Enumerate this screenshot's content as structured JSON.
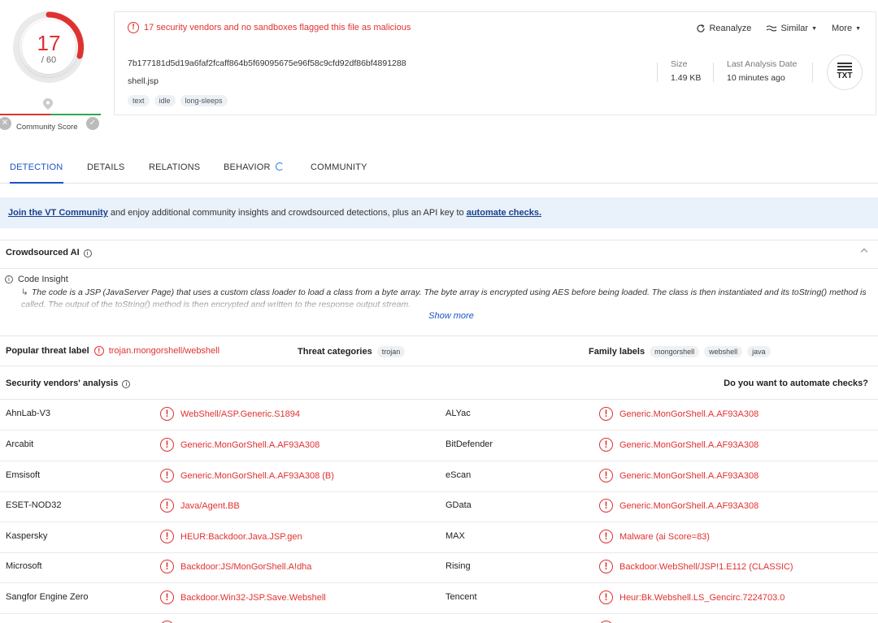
{
  "score": {
    "detections": "17",
    "total": "/ 60",
    "community_label": "Community Score",
    "community_negative": "✕",
    "community_positive": "✓",
    "accent": "#e03131"
  },
  "header": {
    "alert": "17 security vendors and no sandboxes flagged this file as malicious",
    "actions": {
      "reanalyze": "Reanalyze",
      "similar": "Similar",
      "more": "More"
    },
    "hash": "7b177181d5d19a6faf2fcaff864b5f69095675e96f58c9cfd92df86bf4891288",
    "filename": "shell.jsp",
    "tags": [
      "text",
      "idle",
      "long-sleeps"
    ],
    "size_label": "Size",
    "size_value": "1.49 KB",
    "date_label": "Last Analysis Date",
    "date_value": "10 minutes ago",
    "file_type": "TXT"
  },
  "tabs": [
    "DETECTION",
    "DETAILS",
    "RELATIONS",
    "BEHAVIOR",
    "COMMUNITY"
  ],
  "banner": {
    "link1": "Join the VT Community",
    "middle": " and enjoy additional community insights and crowdsourced detections, plus an API key to ",
    "link2": "automate checks."
  },
  "crowdsourced": {
    "title": "Crowdsourced AI",
    "insight_title": "Code Insight",
    "insight_text": "The code is a JSP (JavaServer Page) that uses a custom class loader to load a class from a byte array. The byte array is encrypted using AES before being loaded. The class is then instantiated and its toString() method is called. The output of the toString() method is then encrypted and written to the response output stream.",
    "show_more": "Show more"
  },
  "labels": {
    "popular_label": "Popular threat label",
    "popular_value": "trojan.mongorshell/webshell",
    "categories_label": "Threat categories",
    "categories": [
      "trojan"
    ],
    "family_label": "Family labels",
    "families": [
      "mongorshell",
      "webshell",
      "java"
    ]
  },
  "vendors": {
    "title": "Security vendors' analysis",
    "automate": "Do you want to automate checks?",
    "rows": [
      {
        "v1": "AhnLab-V3",
        "r1": "WebShell/ASP.Generic.S1894",
        "v2": "ALYac",
        "r2": "Generic.MonGorShell.A.AF93A308"
      },
      {
        "v1": "Arcabit",
        "r1": "Generic.MonGorShell.A.AF93A308",
        "v2": "BitDefender",
        "r2": "Generic.MonGorShell.A.AF93A308"
      },
      {
        "v1": "Emsisoft",
        "r1": "Generic.MonGorShell.A.AF93A308 (B)",
        "v2": "eScan",
        "r2": "Generic.MonGorShell.A.AF93A308"
      },
      {
        "v1": "ESET-NOD32",
        "r1": "Java/Agent.BB",
        "v2": "GData",
        "r2": "Generic.MonGorShell.A.AF93A308"
      },
      {
        "v1": "Kaspersky",
        "r1": "HEUR:Backdoor.Java.JSP.gen",
        "v2": "MAX",
        "r2": "Malware (ai Score=83)"
      },
      {
        "v1": "Microsoft",
        "r1": "Backdoor:JS/MonGorShell.A!dha",
        "v2": "Rising",
        "r2": "Backdoor.WebShell/JSP!1.E112 (CLASSIC)"
      },
      {
        "v1": "Sangfor Engine Zero",
        "r1": "Backdoor.Win32-JSP.Save.Webshell",
        "v2": "Tencent",
        "r2": "Heur:Bk.Webshell.LS_Gencirc.7224703.0"
      }
    ]
  }
}
